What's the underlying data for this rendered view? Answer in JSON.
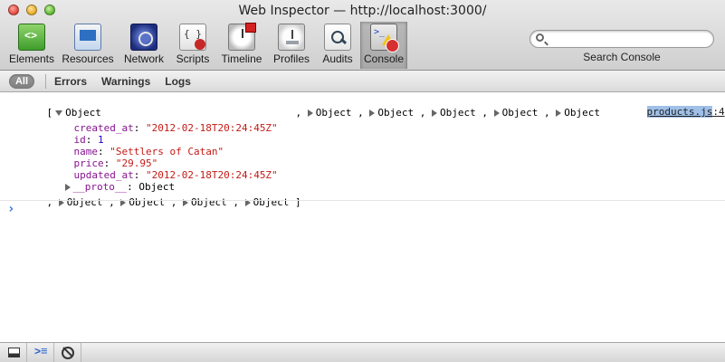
{
  "window": {
    "title": "Web Inspector — http://localhost:3000/"
  },
  "toolbar": {
    "items": [
      {
        "label": "Elements",
        "icon": "elements-icon"
      },
      {
        "label": "Resources",
        "icon": "resources-icon"
      },
      {
        "label": "Network",
        "icon": "network-icon"
      },
      {
        "label": "Scripts",
        "icon": "scripts-icon"
      },
      {
        "label": "Timeline",
        "icon": "timeline-icon"
      },
      {
        "label": "Profiles",
        "icon": "profiles-icon"
      },
      {
        "label": "Audits",
        "icon": "audits-icon"
      },
      {
        "label": "Console",
        "icon": "console-icon",
        "selected": true
      }
    ],
    "search": {
      "value": "",
      "placeholder": "",
      "label": "Search Console"
    }
  },
  "filters": {
    "all": "All",
    "errors": "Errors",
    "warnings": "Warnings",
    "logs": "Logs",
    "selected": "All"
  },
  "console": {
    "source_file": "products.js",
    "source_line": ":4",
    "open_bracket": "[",
    "first_object_label": "Object",
    "object_label": "Object",
    "comma": ",",
    "close_bracket": "]",
    "properties": [
      {
        "key": "created_at",
        "value": "\"2012-02-18T20:24:45Z\"",
        "type": "string"
      },
      {
        "key": "id",
        "value": "1",
        "type": "number"
      },
      {
        "key": "name",
        "value": "\"Settlers of Catan\"",
        "type": "string"
      },
      {
        "key": "price",
        "value": "\"29.95\"",
        "type": "string"
      },
      {
        "key": "updated_at",
        "value": "\"2012-02-18T20:24:45Z\"",
        "type": "string"
      }
    ],
    "proto_key": "__proto__",
    "proto_value": "Object",
    "prompt_symbol": "›"
  },
  "statusbar": {
    "buttons": [
      "dock-icon",
      "console-toggle-icon",
      "clear-icon"
    ]
  },
  "colors": {
    "key": "#881391",
    "string": "#c41a16",
    "number": "#1c00cf",
    "prompt": "#2d6ed6"
  }
}
